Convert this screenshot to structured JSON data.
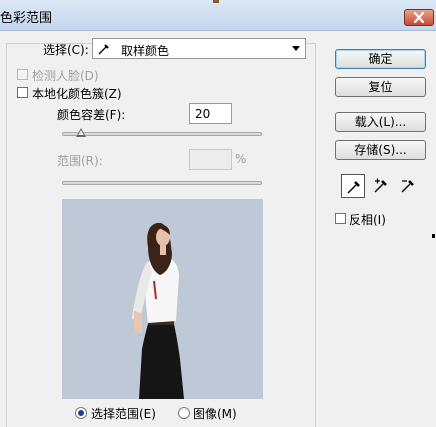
{
  "window": {
    "title": "色彩范围"
  },
  "select": {
    "label": "选择(C):",
    "value": "取样颜色",
    "icon": "eyedropper-icon"
  },
  "detect_faces": {
    "label": "检测人脸(D)",
    "checked": false,
    "enabled": false
  },
  "localized_clusters": {
    "label": "本地化颜色簇(Z)",
    "checked": false
  },
  "fuzziness": {
    "label": "颜色容差(F):",
    "value": "20"
  },
  "range": {
    "label": "范围(R):",
    "value": "",
    "unit": "%"
  },
  "preview_options": {
    "selection": {
      "label": "选择范围(E)",
      "selected": true
    },
    "image": {
      "label": "图像(M)",
      "selected": false
    }
  },
  "buttons": {
    "ok": "确定",
    "reset": "复位",
    "load": "载入(L)...",
    "save": "存储(S)..."
  },
  "tools": [
    "eyedropper-icon",
    "eyedropper-plus-icon",
    "eyedropper-minus-icon"
  ],
  "invert": {
    "label": "反相(I)",
    "checked": false
  },
  "colors": {
    "title_bar": "#c5d7ee",
    "close_button": "#c74a31",
    "preview_background": "#bfc8d6"
  }
}
